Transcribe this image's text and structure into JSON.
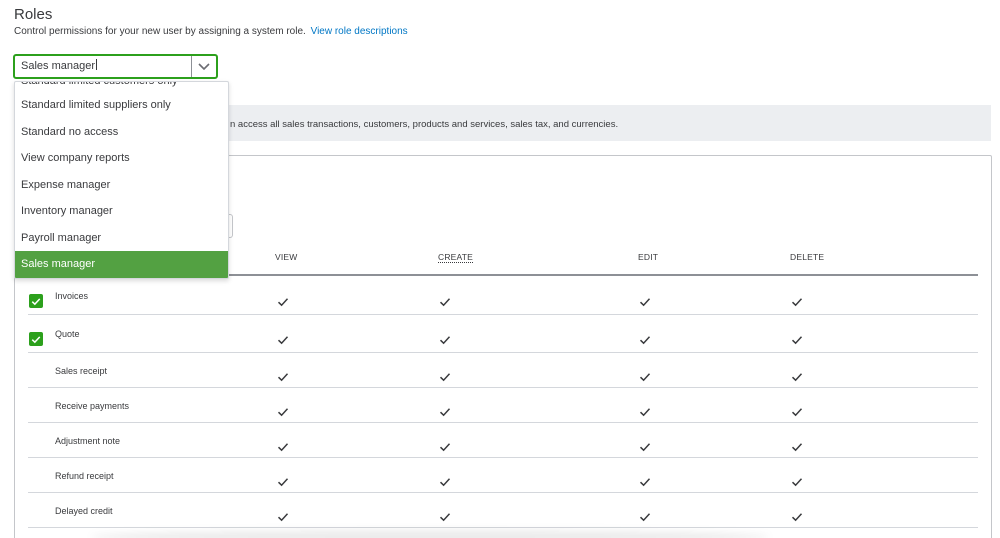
{
  "header": {
    "title": "Roles",
    "description": "Control permissions for your new user by assigning a system role.",
    "link_label": "View role descriptions"
  },
  "role_select": {
    "value": "Sales manager",
    "options": [
      "Standard limited customers only",
      "Standard limited suppliers only",
      "Standard no access",
      "View company reports",
      "Expense manager",
      "Inventory manager",
      "Payroll manager",
      "Sales manager"
    ],
    "selected": "Sales manager"
  },
  "info": {
    "text": "n access all sales transactions, customers, products and services, sales tax, and currencies."
  },
  "table": {
    "columns": [
      "VIEW",
      "CREATE",
      "EDIT",
      "DELETE"
    ],
    "rows": [
      {
        "label": "Invoices",
        "checkbox": true
      },
      {
        "label": "Quote",
        "checkbox": true
      },
      {
        "label": "Sales receipt",
        "checkbox": false
      },
      {
        "label": "Receive payments",
        "checkbox": false
      },
      {
        "label": "Adjustment note",
        "checkbox": false
      },
      {
        "label": "Refund receipt",
        "checkbox": false
      },
      {
        "label": "Delayed credit",
        "checkbox": false
      }
    ]
  },
  "colors": {
    "accent_green": "#2ca01c",
    "selected_bg": "#53a142",
    "link": "#0077c5",
    "info_bg": "#eceef1"
  }
}
